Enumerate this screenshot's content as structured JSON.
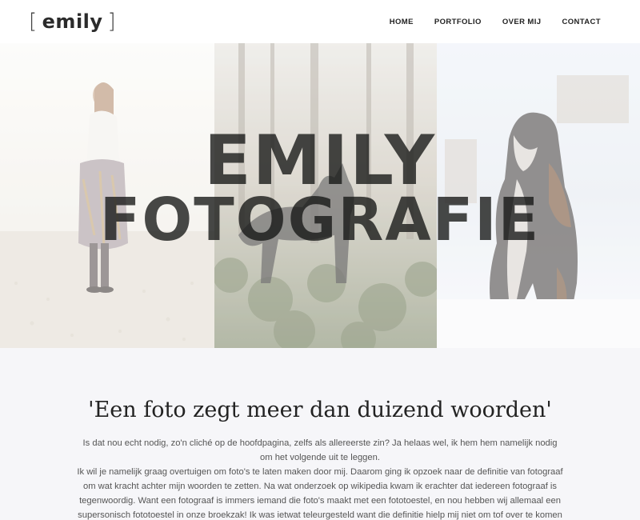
{
  "logo": {
    "bracket_left": "[",
    "text": "emily",
    "bracket_right": "]"
  },
  "nav": {
    "items": [
      {
        "label": "HOME"
      },
      {
        "label": "PORTFOLIO"
      },
      {
        "label": "OVER MIJ"
      },
      {
        "label": "CONTACT"
      }
    ]
  },
  "hero": {
    "title_line1": "EMILY",
    "title_line2": "FOTOGRAFIE",
    "images": [
      "woman-on-beach",
      "dog-in-forest",
      "bernese-dog-in-snow"
    ]
  },
  "intro": {
    "quote": "'Een foto zegt meer dan duizend woorden'",
    "paragraph1": "Is dat nou echt nodig, zo'n cliché op de hoofdpagina, zelfs als allereerste zin? Ja helaas wel, ik hem hem namelijk nodig om het volgende uit te leggen.",
    "paragraph2": "Ik wil je namelijk graag overtuigen om foto's te laten maken door mij. Daarom ging ik opzoek naar de definitie van fotograaf om wat kracht achter mijn woorden te zetten. Na wat onderzoek op wikipedia kwam ik erachter dat iedereen fotograaf is tegenwoordig. Want een fotograaf is immers iemand die foto's maakt met een fototoestel, en nou hebben wij allemaal een supersonisch fototoestel in onze broekzak! Ik was ietwat teleurgesteld want die definitie hielp mij niet om tof over te komen als"
  },
  "colors": {
    "background": "#f6f6f9",
    "header": "#ffffff",
    "text": "#555555"
  }
}
